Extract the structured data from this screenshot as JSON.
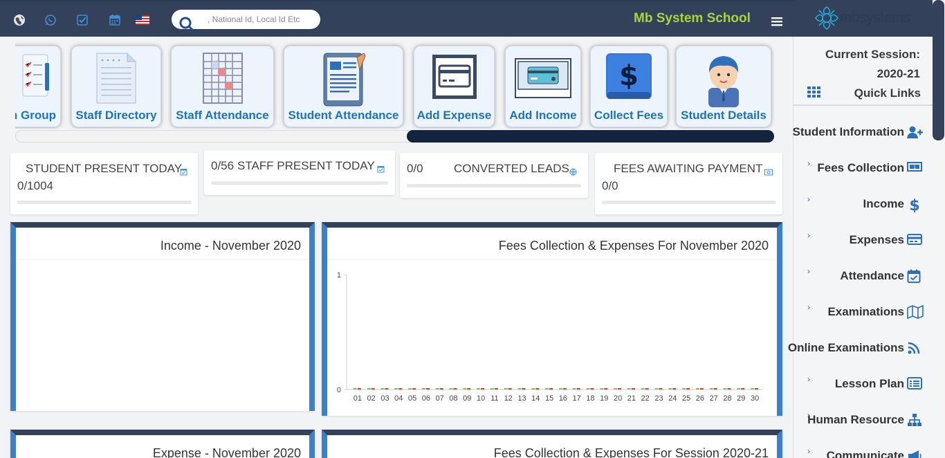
{
  "header": {
    "school_name": "Mb System School",
    "search_placeholder": ", National Id, Local Id Etc",
    "logo_text": "mbsystems",
    "icons": [
      "globe-icon",
      "whatsapp-icon",
      "check-square-icon",
      "calendar-icon",
      "us-flag-icon",
      "search-icon",
      "menu-icon"
    ]
  },
  "quick_links": [
    {
      "label": "n Group",
      "icon": "checklist-icon"
    },
    {
      "label": "Staff Directory",
      "icon": "document-icon"
    },
    {
      "label": "Staff Attendance",
      "icon": "grid-sheet-icon"
    },
    {
      "label": "Student Attendance",
      "icon": "tablet-notes-icon"
    },
    {
      "label": "Add Expense",
      "icon": "credit-card-icon"
    },
    {
      "label": "Add Income",
      "icon": "monitor-card-icon"
    },
    {
      "label": "Collect Fees",
      "icon": "dollar-icon"
    },
    {
      "label": "Student Details",
      "icon": "student-avatar-icon"
    }
  ],
  "sidebar": {
    "session_label": "Current Session:",
    "session_value": "2020-21",
    "quick_links_label": "Quick Links",
    "items": [
      {
        "label": "Student Information",
        "icon": "user-plus-icon",
        "chevron": false
      },
      {
        "label": "Fees Collection",
        "icon": "money-icon",
        "chevron": true
      },
      {
        "label": "Income",
        "icon": "dollar-sign-icon",
        "chevron": true
      },
      {
        "label": "Expenses",
        "icon": "credit-card-icon",
        "chevron": true
      },
      {
        "label": "Attendance",
        "icon": "calendar-check-icon",
        "chevron": true
      },
      {
        "label": "Examinations",
        "icon": "map-icon",
        "chevron": true
      },
      {
        "label": "Online Examinations",
        "icon": "rss-icon",
        "chevron": false
      },
      {
        "label": "Lesson Plan",
        "icon": "list-alt-icon",
        "chevron": true
      },
      {
        "label": "Human Resource",
        "icon": "sitemap-icon",
        "chevron": true
      },
      {
        "label": "Communicate",
        "icon": "bullhorn-icon",
        "chevron": true
      }
    ]
  },
  "stats": [
    {
      "title": "STUDENT PRESENT TODAY",
      "value": "0/1004",
      "icon": "calendar-check-icon"
    },
    {
      "title": "STAFF PRESENT TODAY",
      "value": "0/56",
      "icon": "calendar-check-icon"
    },
    {
      "title": "CONVERTED LEADS",
      "value": "0/0",
      "icon": "globe-icon"
    },
    {
      "title": "FEES AWAITING PAYMENT",
      "value": "0/0",
      "icon": "money-icon"
    }
  ],
  "panels": {
    "income_title": "Income - November 2020",
    "fees_title": "Fees Collection & Expenses For November 2020",
    "expense_title": "Expense - November 2020",
    "session_title": "Fees Collection & Expenses For Session 2020-21"
  },
  "colors": {
    "header_bg": "#33425a",
    "accent": "#3d7fc9",
    "school_name": "#a7d63a",
    "link": "#1b73b8"
  },
  "chart_data": {
    "type": "bar",
    "title": "Fees Collection & Expenses For November 2020",
    "categories": [
      "01",
      "02",
      "03",
      "04",
      "05",
      "06",
      "07",
      "08",
      "09",
      "10",
      "11",
      "12",
      "13",
      "14",
      "15",
      "16",
      "17",
      "18",
      "19",
      "20",
      "21",
      "22",
      "23",
      "24",
      "25",
      "26",
      "27",
      "28",
      "29",
      "30"
    ],
    "series": [
      {
        "values": [
          0,
          0,
          0,
          0,
          0,
          0,
          0,
          0,
          0,
          0,
          0,
          0,
          0,
          0,
          0,
          0,
          0,
          0,
          0,
          0,
          0,
          0,
          0,
          0,
          0,
          0,
          0,
          0,
          0,
          0
        ],
        "color": "#8bc34a"
      },
      {
        "values": [
          0,
          0,
          0,
          0,
          0,
          0,
          0,
          0,
          0,
          0,
          0,
          0,
          0,
          0,
          0,
          0,
          0,
          0,
          0,
          0,
          0,
          0,
          0,
          0,
          0,
          0,
          0,
          0,
          0,
          0
        ],
        "color": "#e53935"
      }
    ],
    "yticks": [
      "0",
      "1"
    ],
    "ylim": [
      0,
      1
    ]
  }
}
